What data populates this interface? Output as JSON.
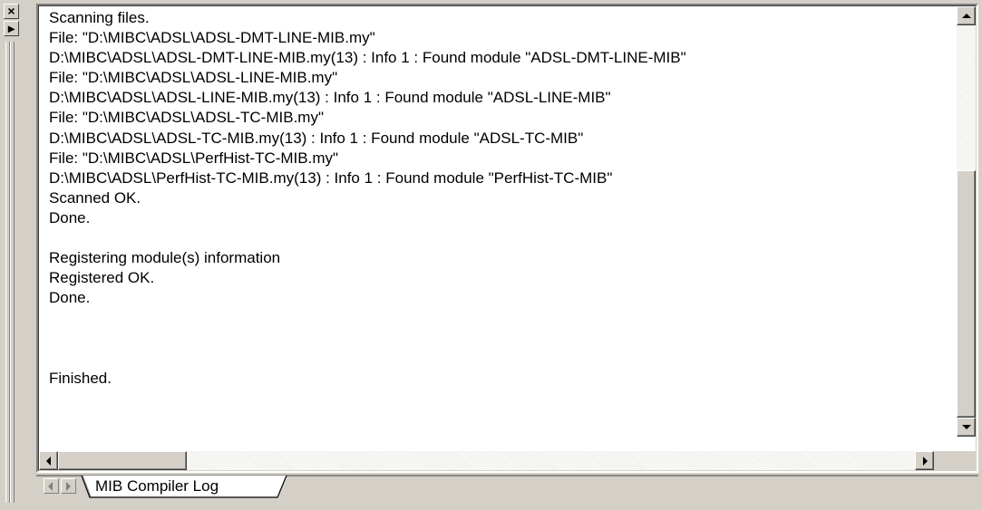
{
  "dock": {
    "close_glyph": "×",
    "expand_glyph": "▸"
  },
  "log": {
    "lines": [
      "Scanning files.",
      "File: \"D:\\MIBC\\ADSL\\ADSL-DMT-LINE-MIB.my\"",
      "D:\\MIBC\\ADSL\\ADSL-DMT-LINE-MIB.my(13) : Info 1 : Found module \"ADSL-DMT-LINE-MIB\"",
      "File: \"D:\\MIBC\\ADSL\\ADSL-LINE-MIB.my\"",
      "D:\\MIBC\\ADSL\\ADSL-LINE-MIB.my(13) : Info 1 : Found module \"ADSL-LINE-MIB\"",
      "File: \"D:\\MIBC\\ADSL\\ADSL-TC-MIB.my\"",
      "D:\\MIBC\\ADSL\\ADSL-TC-MIB.my(13) : Info 1 : Found module \"ADSL-TC-MIB\"",
      "File: \"D:\\MIBC\\ADSL\\PerfHist-TC-MIB.my\"",
      "D:\\MIBC\\ADSL\\PerfHist-TC-MIB.my(13) : Info 1 : Found module \"PerfHist-TC-MIB\"",
      "Scanned OK.",
      "Done.",
      "",
      "Registering module(s) information",
      "Registered OK.",
      "Done.",
      "",
      "",
      "",
      "Finished."
    ]
  },
  "scroll": {
    "vertical_position_fraction": 1.0,
    "vertical_visible_fraction": 0.63,
    "horizontal_position_fraction": 0.0,
    "horizontal_visible_fraction": 0.15
  },
  "tabs": [
    {
      "label": "MIB Compiler Log",
      "active": true
    }
  ],
  "colors": {
    "face": "#d4d0c8",
    "shadow": "#808080",
    "dark_shadow": "#404040",
    "highlight": "#ffffff",
    "text": "#000000",
    "log_background": "#ffffff"
  }
}
